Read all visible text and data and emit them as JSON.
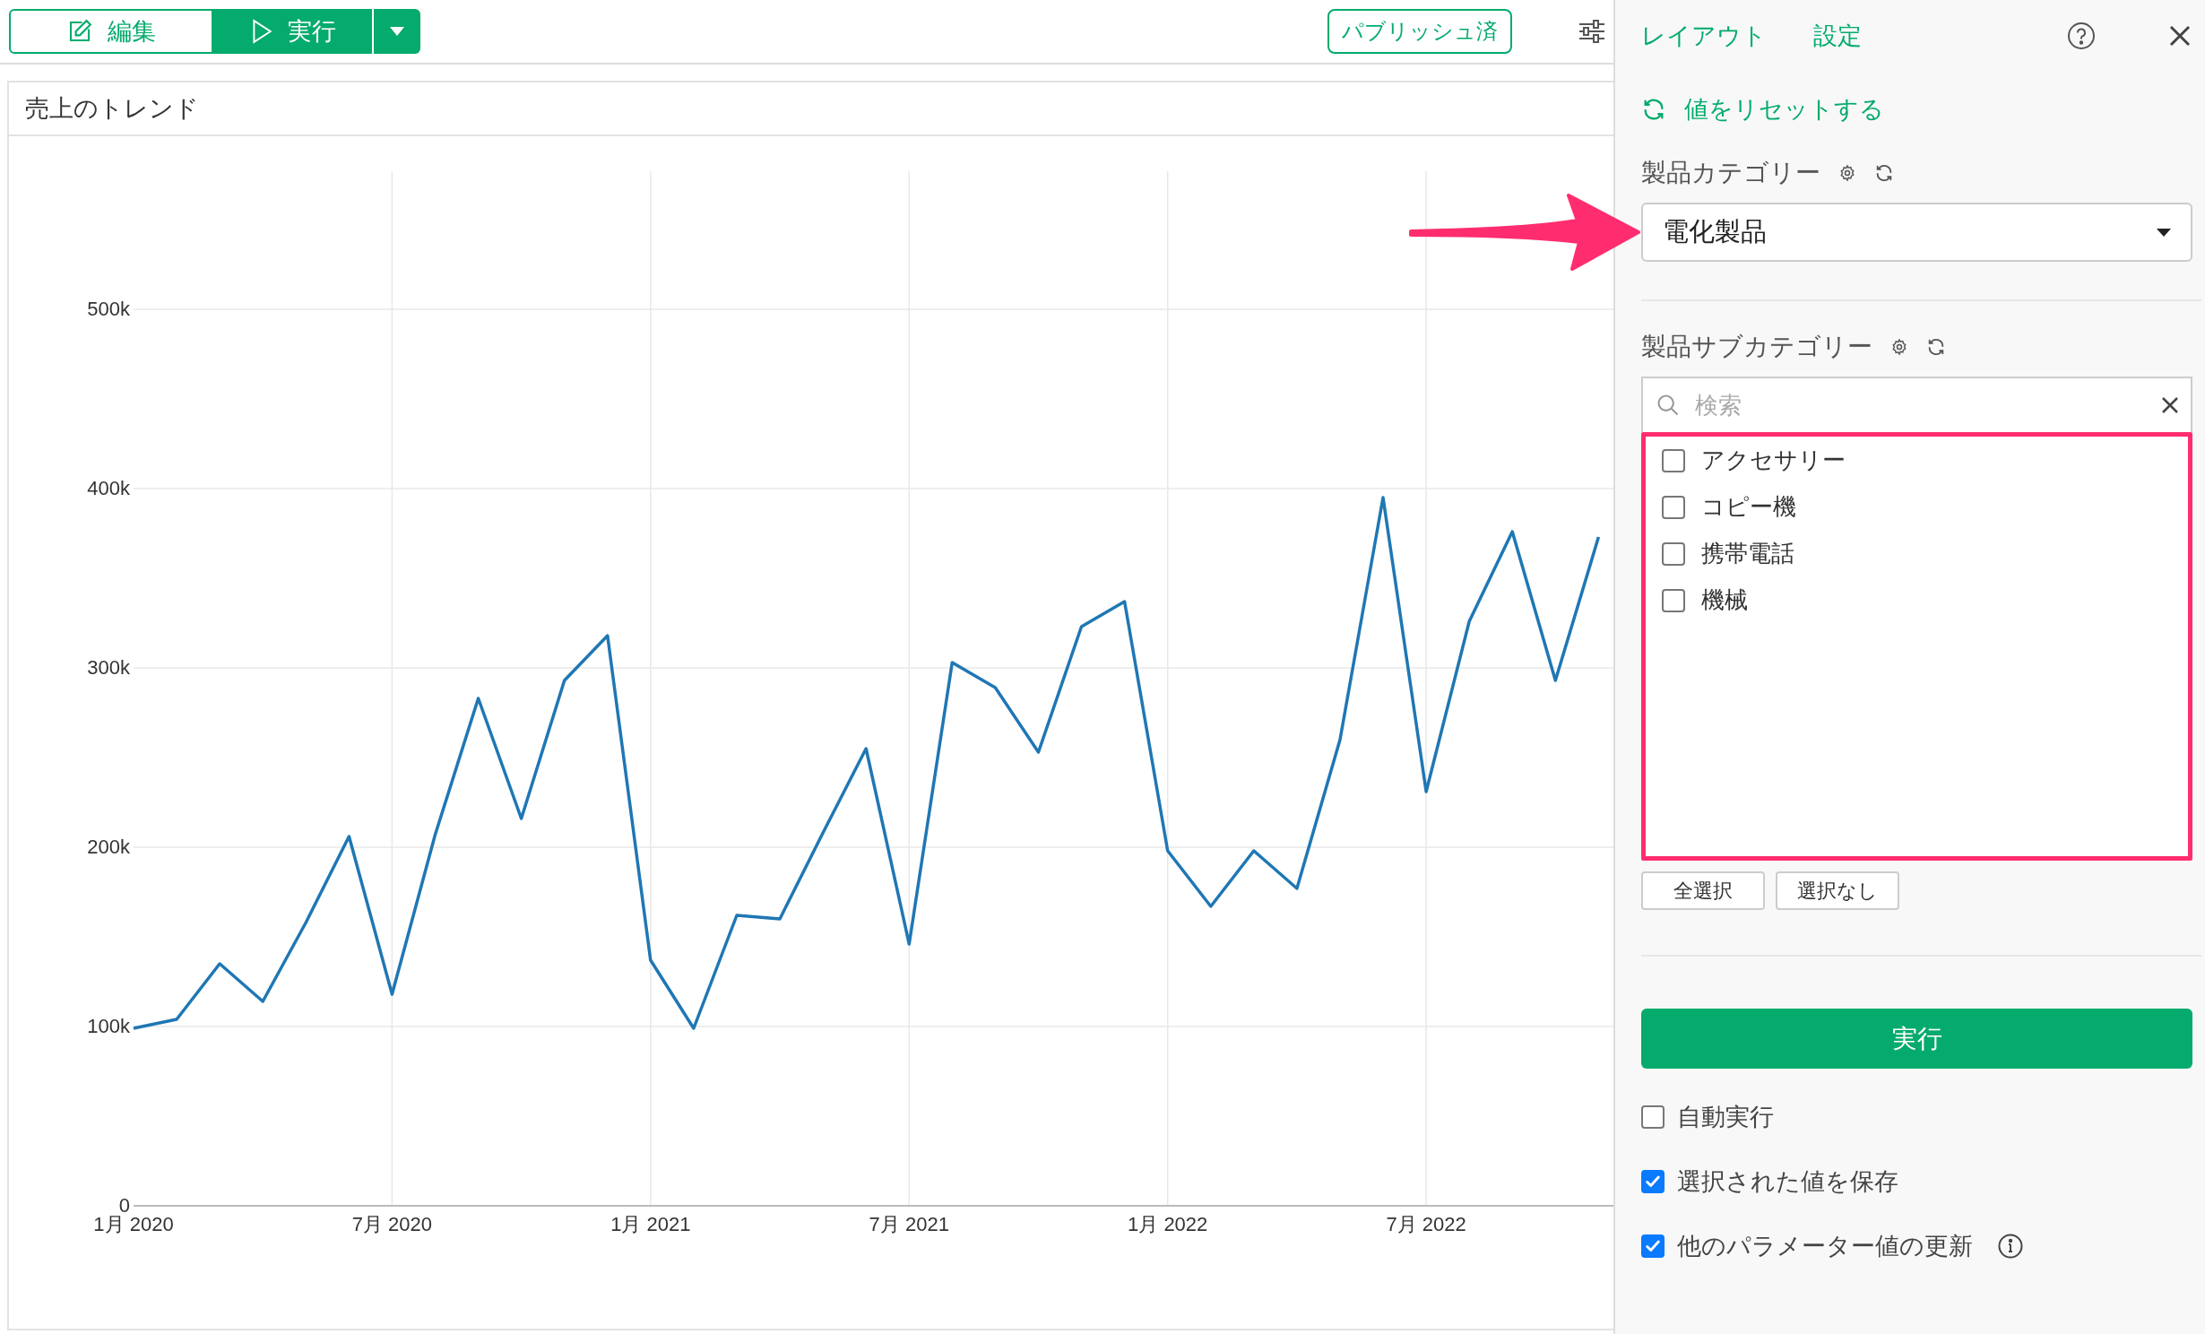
{
  "toolbar": {
    "edit_button": "編集",
    "run_button": "実行",
    "published_badge": "パブリッシュ済"
  },
  "chart_card": {
    "title": "売上のトレンド",
    "chart_data": {
      "type": "line",
      "categories": [
        "1月 2020",
        null,
        null,
        null,
        null,
        null,
        "7月 2020",
        null,
        null,
        null,
        null,
        null,
        "1月 2021",
        null,
        null,
        null,
        null,
        null,
        "7月 2021",
        null,
        null,
        null,
        null,
        null,
        "1月 2022",
        null,
        null,
        null,
        null,
        null,
        "7月 2022",
        null,
        null,
        null,
        null,
        null
      ],
      "series": [
        {
          "color": "#1f77b4",
          "values": [
            99000,
            104000,
            135000,
            114000,
            158000,
            206000,
            118000,
            207000,
            283000,
            216000,
            293000,
            318000,
            137000,
            99000,
            162000,
            160000,
            208000,
            255000,
            146000,
            303000,
            289000,
            253000,
            323000,
            337000,
            198000,
            167000,
            198000,
            177000,
            260000,
            395000,
            231000,
            326000,
            376000,
            293000,
            373000,
            null
          ]
        }
      ],
      "ylim": [
        0,
        577000
      ],
      "grid": true,
      "yticks": [
        {
          "value": 0,
          "label": "0"
        },
        {
          "value": 100000,
          "label": "100k"
        },
        {
          "value": 200000,
          "label": "200k"
        },
        {
          "value": 300000,
          "label": "300k"
        },
        {
          "value": 400000,
          "label": "400k"
        },
        {
          "value": 500000,
          "label": "500k"
        }
      ]
    }
  },
  "panel": {
    "header_links": [
      "レイアウト",
      "設定"
    ],
    "reset_link": "値をリセットする",
    "parameters": [
      {
        "kind": "dropdown",
        "label": "製品カテゴリー",
        "value": "電化製品"
      },
      {
        "kind": "checklist",
        "label": "製品サブカテゴリー",
        "placeholder": "検索",
        "options": [
          {
            "label": "アクセサリー",
            "checked": false
          },
          {
            "label": "コピー機",
            "checked": false
          },
          {
            "label": "携帯電話",
            "checked": false
          },
          {
            "label": "機械",
            "checked": false
          }
        ],
        "buttons": [
          "全選択",
          "選択なし"
        ]
      }
    ],
    "run_button": "実行",
    "options": [
      {
        "label": "自動実行",
        "checked": false,
        "info": false
      },
      {
        "label": "選択された値を保存",
        "checked": true,
        "info": false
      },
      {
        "label": "他のパラメーター値の更新",
        "checked": true,
        "info": true
      }
    ]
  }
}
